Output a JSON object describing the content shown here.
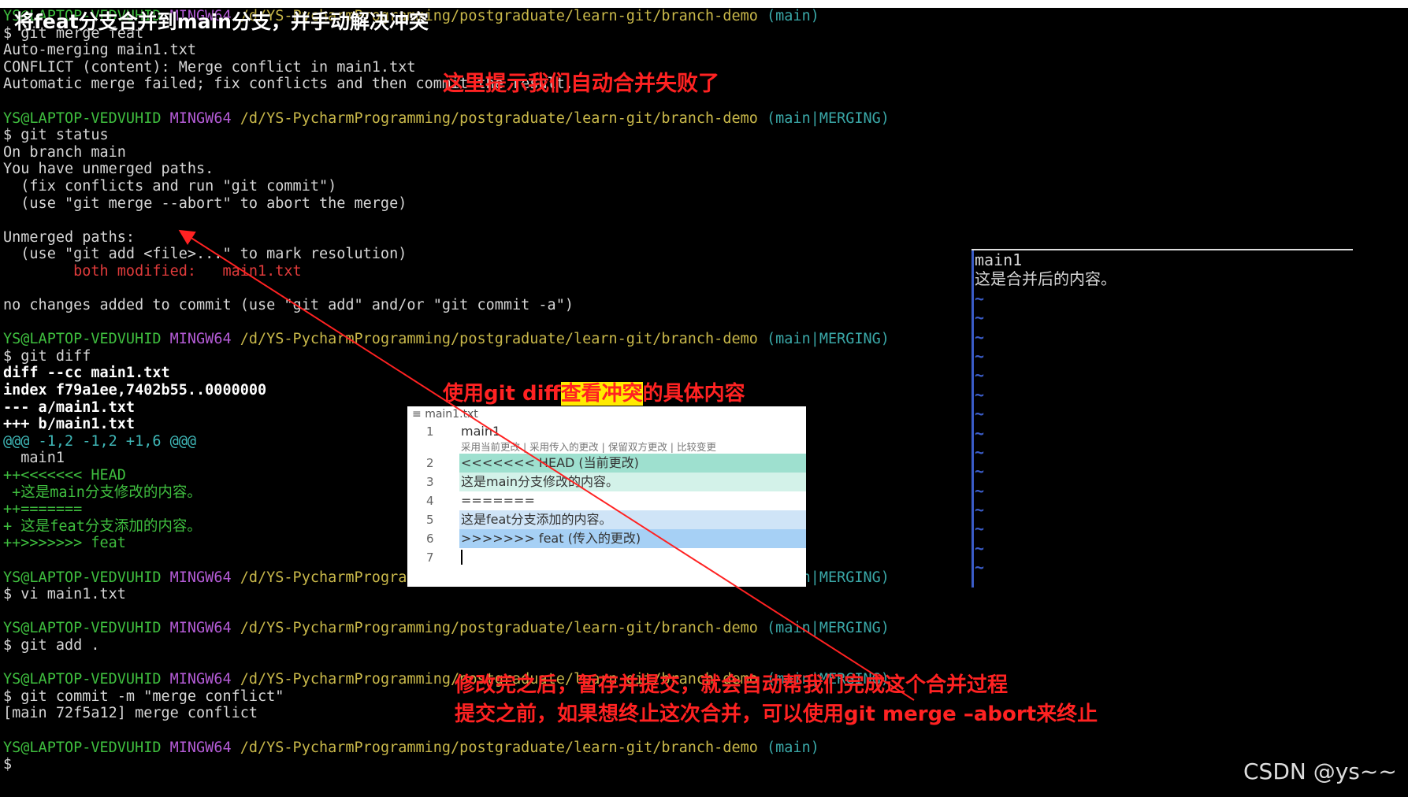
{
  "title": "将feat分支合并到main分支，并手动解决冲突",
  "prompt": {
    "user": "YS@LAPTOP-VEDVUHID",
    "shell": "MINGW64",
    "path": "/d/YS-PycharmProgramming/postgraduate/learn-git/branch-demo",
    "branch_main": "(main)",
    "branch_merging": "(main|MERGING)"
  },
  "terminal": {
    "l1": "$ git merge feat",
    "l2": "Auto-merging main1.txt",
    "l3": "CONFLICT (content): Merge conflict in main1.txt",
    "l4": "Automatic merge failed; fix conflicts and then commit the result.",
    "s1": "$ git status",
    "s2": "On branch main",
    "s3": "You have unmerged paths.",
    "s4": "  (fix conflicts and run \"git commit\")",
    "s5": "  (use \"git merge --abort\" to abort the merge)",
    "s6": "Unmerged paths:",
    "s7": "  (use \"git add <file>...\" to mark resolution)",
    "s8": "        both modified:   main1.txt",
    "s9": "no changes added to commit (use \"git add\" and/or \"git commit -a\")",
    "d1": "$ git diff",
    "d2": "diff --cc main1.txt",
    "d3": "index f79a1ee,7402b55..0000000",
    "d4": "--- a/main1.txt",
    "d5": "+++ b/main1.txt",
    "d6": "@@@ -1,2 -1,2 +1,6 @@@",
    "d7": "  main1",
    "d8": "++<<<<<<< HEAD",
    "d9": " +这是main分支修改的内容。",
    "d10": "++=======",
    "d11": "+ 这是feat分支添加的内容。",
    "d12": "++>>>>>>> feat",
    "v1": "$ vi main1.txt",
    "a1": "$ git add .",
    "c1": "$ git commit -m \"merge conflict\"",
    "c2": "[main 72f5a12] merge conflict",
    "end": "$"
  },
  "annotations": {
    "merge_failed": "这里提示我们自动合并失败了",
    "diff_pre": "使用git diff",
    "diff_hl": "查看冲突",
    "diff_post": "的具体内容",
    "after1": "修改完之后，暂存并提交，就会自动帮我们完成这个合并过程",
    "after2": "提交之前，如果想终止这次合并，可以使用git merge –abort来终止"
  },
  "editor": {
    "tab": "main1.txt",
    "actions": "采用当前更改 | 采用传入的更改 | 保留双方更改 | 比较变更",
    "lines": [
      {
        "num": "1",
        "text": "main1"
      },
      {
        "num": "2",
        "text": "<<<<<<< HEAD (当前更改)"
      },
      {
        "num": "3",
        "text": "这是main分支修改的内容。"
      },
      {
        "num": "4",
        "text": "======="
      },
      {
        "num": "5",
        "text": "这是feat分支添加的内容。"
      },
      {
        "num": "6",
        "text": ">>>>>>> feat (传入的更改)"
      },
      {
        "num": "7",
        "text": ""
      }
    ]
  },
  "vim": {
    "line1": "main1",
    "line2": "这是合并后的内容。",
    "tilde": "~"
  },
  "watermark": "CSDN @ys~~",
  "colors": {
    "annotation_red": "#ff2222",
    "highlight_yellow": "#ffea00",
    "prompt_green": "#3fbf3f"
  }
}
